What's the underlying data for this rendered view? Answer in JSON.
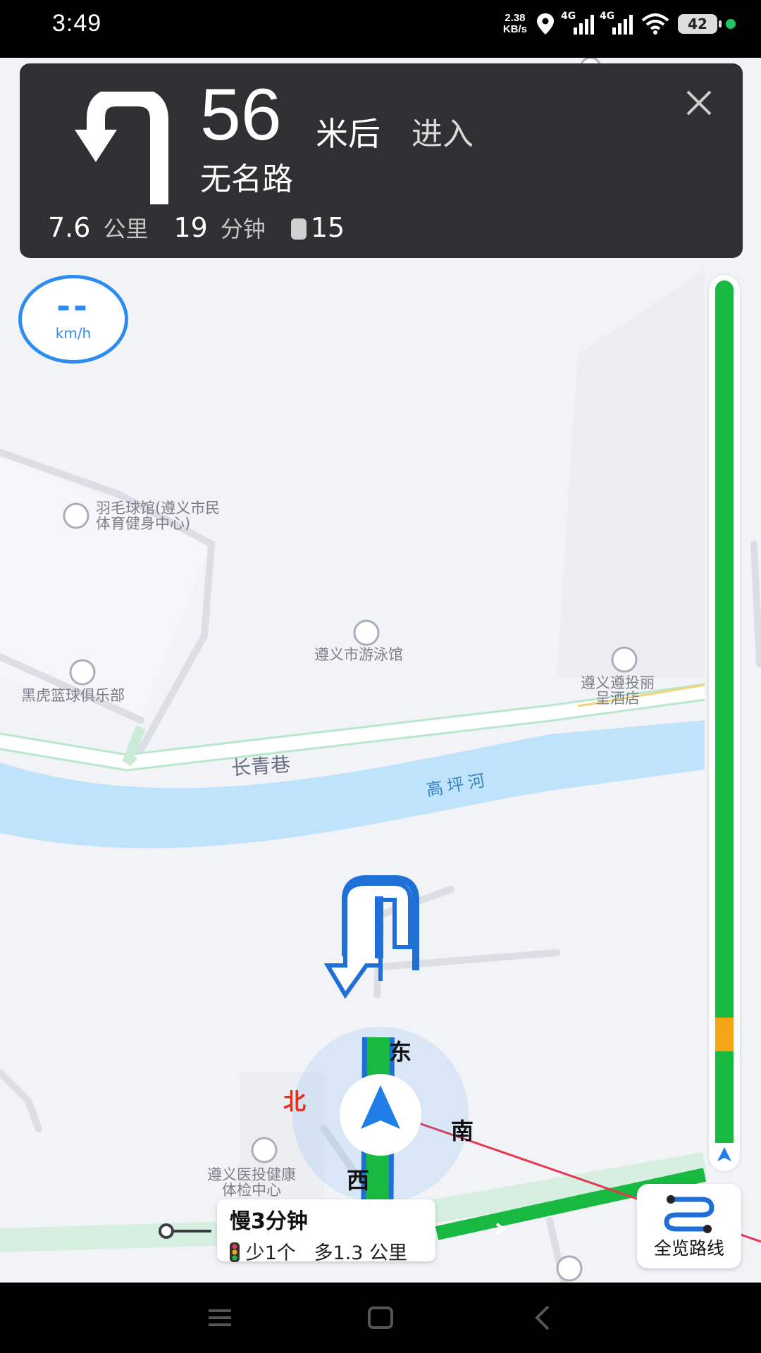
{
  "status_bar": {
    "time": "3:49",
    "net_speed_value": "2.38",
    "net_speed_unit": "KB/s",
    "sim1": "4G",
    "sim2": "4G",
    "battery": "42"
  },
  "nav_card": {
    "distance": "56",
    "distance_unit": "米后",
    "action": "进入",
    "road_name": "无名路",
    "remaining_distance": "7.6",
    "remaining_distance_unit": "公里",
    "remaining_time": "19",
    "remaining_time_unit": "分钟",
    "traffic_lights": "15"
  },
  "speed": {
    "value": "--",
    "unit": "km/h"
  },
  "map": {
    "pois": {
      "badminton": "羽毛球馆(遵义市民\n体育健身中心)",
      "swimming": "遵义市游泳馆",
      "basketball": "黑虎篮球俱乐部",
      "hotel": "遵义遵投丽\n呈酒店",
      "medical": "遵义医投健康\n体检中心"
    },
    "road_changqing": "长青巷",
    "river": "高坪河",
    "compass": {
      "north": "北",
      "east": "东",
      "south": "南",
      "west": "西"
    }
  },
  "alt_route": {
    "time": "慢3分钟",
    "lights": "少1个",
    "distance": "多1.3 公里"
  },
  "overview_button": "全览路线",
  "colors": {
    "route_green": "#18b940",
    "traffic_orange": "#f5a614",
    "accent_blue": "#2d8cf0"
  }
}
